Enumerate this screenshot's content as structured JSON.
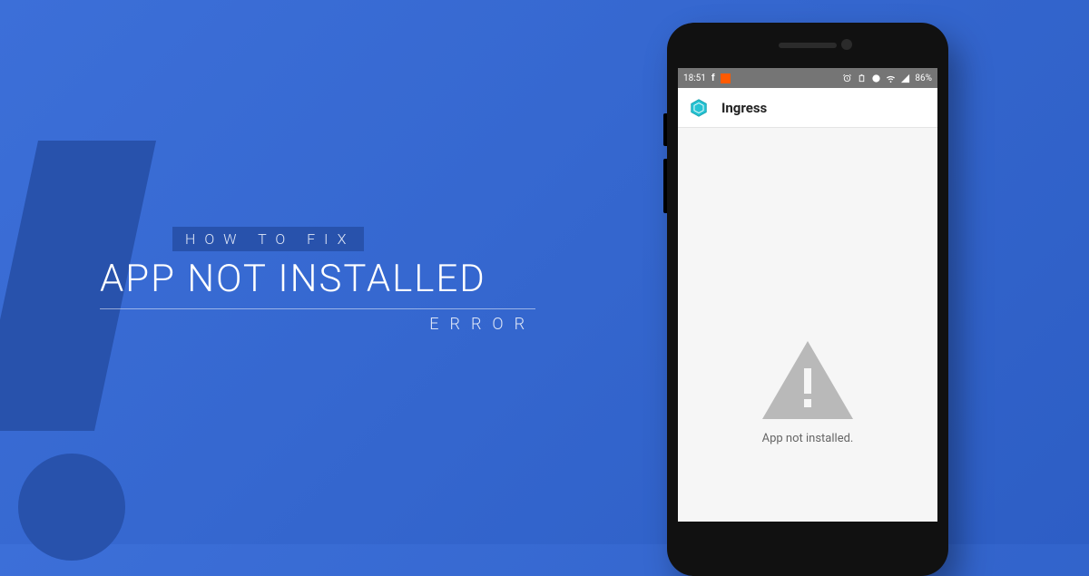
{
  "headline": {
    "howto": "HOW TO FIX",
    "main": "APP NOT INSTALLED",
    "error": "ERROR"
  },
  "phone": {
    "status": {
      "time": "18:51",
      "battery": "86%"
    },
    "app_bar": {
      "title": "Ingress"
    },
    "content": {
      "message": "App not installed."
    }
  }
}
